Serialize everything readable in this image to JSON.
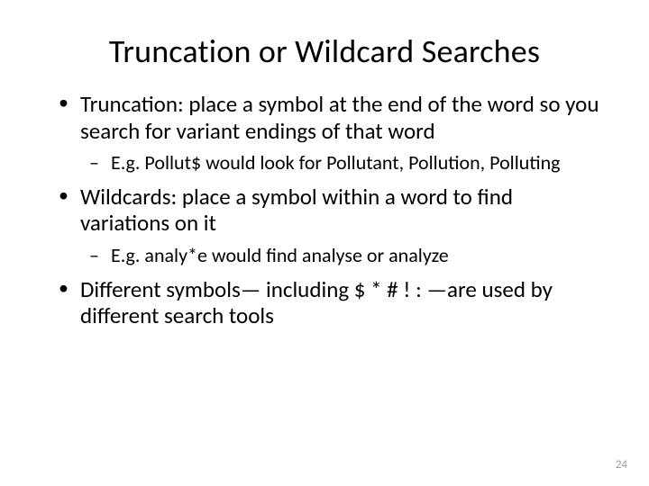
{
  "slide": {
    "title": "Truncation or Wildcard Searches",
    "bullets": [
      {
        "text": "Truncation:  place a symbol at the end of the word so you search for variant endings of that word",
        "sub": [
          "E.g. Pollut$ would look for Pollutant, Pollution, Polluting"
        ]
      },
      {
        "text": "Wildcards: place a symbol within a word to find variations on it",
        "sub": [
          "E.g.  analy*e would find analyse or analyze"
        ]
      },
      {
        "text": "Different symbols— including $ * # ! : —are used by different search tools",
        "sub": []
      }
    ],
    "page_number": "24"
  }
}
